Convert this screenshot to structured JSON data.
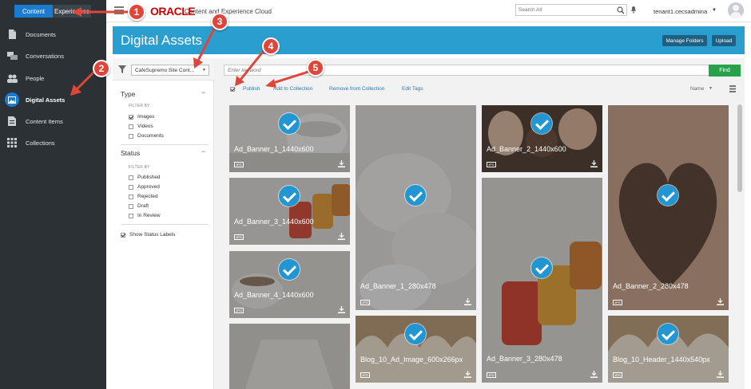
{
  "app": {
    "mode_tabs": [
      {
        "label": "Content",
        "active": true
      },
      {
        "label": "Experiences",
        "active": false
      }
    ],
    "logo_text": "ORACLE",
    "product_name": "Content and Experience Cloud",
    "search_placeholder": "Search All",
    "user_name": "tenant1.cecsadmina",
    "accent_color": "#2b9ed0",
    "callout_color": "#e0453a"
  },
  "sidebar": {
    "items": [
      {
        "label": "Documents",
        "icon": "documents-icon",
        "active": false
      },
      {
        "label": "Conversations",
        "icon": "conversations-icon",
        "active": false
      },
      {
        "label": "People",
        "icon": "people-icon",
        "active": false
      },
      {
        "label": "Digital Assets",
        "icon": "image-icon",
        "active": true
      },
      {
        "label": "Content Items",
        "icon": "content-items-icon",
        "active": false
      },
      {
        "label": "Collections",
        "icon": "collections-icon",
        "active": false
      }
    ]
  },
  "banner": {
    "title": "Digital Assets",
    "manage_folders": "Manage Folders",
    "upload": "Upload"
  },
  "filters": {
    "collection_value": "CafeSupremo Site Cont...",
    "type_heading": "Type",
    "type_filter_by": "FILTER BY",
    "type_options": [
      {
        "label": "Images",
        "checked": true
      },
      {
        "label": "Videos",
        "checked": false
      },
      {
        "label": "Documents",
        "checked": false
      }
    ],
    "status_heading": "Status",
    "status_filter_by": "FILTER BY",
    "status_options": [
      {
        "label": "Published",
        "checked": false
      },
      {
        "label": "Approved",
        "checked": false
      },
      {
        "label": "Rejected",
        "checked": false
      },
      {
        "label": "Draft",
        "checked": false
      },
      {
        "label": "In Review",
        "checked": false
      }
    ],
    "show_status_labels": "Show Status Labels",
    "show_status_checked": true
  },
  "toolbar": {
    "keyword_placeholder": "Enter keyword",
    "find": "Find",
    "actions": [
      "Publish",
      "Add to Collection",
      "Remove from Collection",
      "Edit Tags"
    ],
    "sort": "Name"
  },
  "assets": [
    {
      "name": "Ad_Banner_1_1440x600",
      "type": "JPG",
      "selected": true
    },
    {
      "name": "Ad_Banner_3_1440x600",
      "type": "JPG",
      "selected": true
    },
    {
      "name": "Ad_Banner_4_1440x600",
      "type": "JPG",
      "selected": true
    },
    {
      "name": "Ad_Banner_1_280x478",
      "type": "JPG",
      "selected": true
    },
    {
      "name": "Blog_10_Ad_Image_600x266px",
      "type": "JPG",
      "selected": true
    },
    {
      "name": "Ad_Banner_2_1440x600",
      "type": "JPG",
      "selected": true
    },
    {
      "name": "Ad_Banner_3_280x478",
      "type": "JPG",
      "selected": true
    },
    {
      "name": "Ad_Banner_2_280x478",
      "type": "JPG",
      "selected": true
    },
    {
      "name": "Blog_10_Header_1440x540px",
      "type": "JPG",
      "selected": true
    }
  ],
  "callouts": [
    "1",
    "2",
    "3",
    "4",
    "5"
  ]
}
